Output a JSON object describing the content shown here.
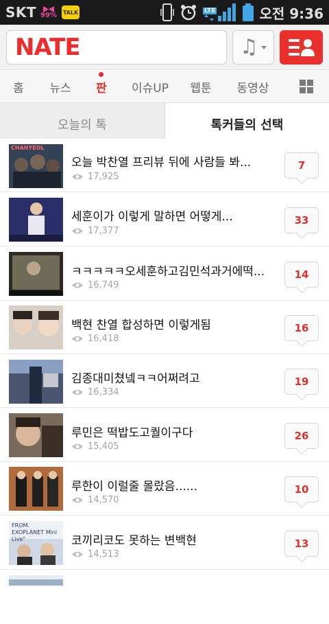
{
  "status_bar": {
    "carrier": "SKT",
    "battery_percent": "99%",
    "talk_label": "TALK",
    "network": "LTE",
    "time": "오전 9:36"
  },
  "header": {
    "logo": "NATE",
    "search_placeholder": ""
  },
  "nav": {
    "items": [
      {
        "label": "홈"
      },
      {
        "label": "뉴스"
      },
      {
        "label": "판"
      },
      {
        "label": "이슈UP"
      },
      {
        "label": "웹툰"
      },
      {
        "label": "동영상"
      }
    ],
    "active_index": 2
  },
  "subtabs": {
    "left": "오늘의 톡",
    "right": "톡커들의 선택",
    "active": "right"
  },
  "posts": [
    {
      "title": "오늘 박찬열 프리뷰 뒤에 사람들 봐...",
      "views": "17,925",
      "comments": "7"
    },
    {
      "title": "세훈이가 이렇게 말하면 어떻게...",
      "views": "17,377",
      "comments": "33"
    },
    {
      "title": "ㅋㅋㅋㅋㅋ오세훈하고김민석과거에떡...",
      "views": "16,749",
      "comments": "14"
    },
    {
      "title": "백현 찬열 합성하면 이렇게됨",
      "views": "16,418",
      "comments": "16"
    },
    {
      "title": "김종대미쳤넼ㅋㅋ어쩌려고",
      "views": "16,334",
      "comments": "19"
    },
    {
      "title": "루민은 떡밥도고퀄이구다",
      "views": "15,405",
      "comments": "26"
    },
    {
      "title": "루한이 이럴줄 몰랐음......",
      "views": "14,570",
      "comments": "10"
    },
    {
      "title": "코끼리코도 못하는 변백현",
      "views": "14,513",
      "comments": "13"
    }
  ],
  "thumb_texts": [
    "CHANYEOL",
    "",
    "",
    "",
    "",
    "",
    "",
    "FROM. EXOPLANET  Mini Live\""
  ],
  "colors": {
    "brand_red": "#e9302c",
    "comment_red": "#e0302a"
  }
}
